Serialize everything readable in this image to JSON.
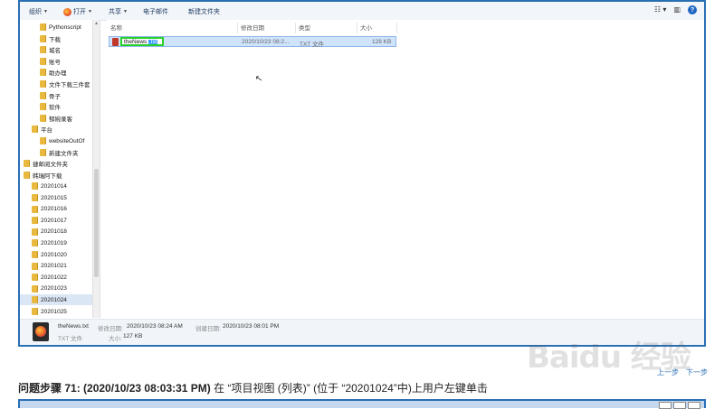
{
  "toolbar": {
    "organize": "组织",
    "open": "打开",
    "share": "共享",
    "email": "电子邮件",
    "new_folder": "新建文件夹"
  },
  "nav": {
    "items": [
      {
        "label": "Pythonscript",
        "indent": 2
      },
      {
        "label": "下载",
        "indent": 2
      },
      {
        "label": "城名",
        "indent": 2
      },
      {
        "label": "账号",
        "indent": 2
      },
      {
        "label": "助办理",
        "indent": 2
      },
      {
        "label": "文件下载三件套",
        "indent": 2
      },
      {
        "label": "骨子",
        "indent": 2
      },
      {
        "label": "软件",
        "indent": 2
      },
      {
        "label": "郁婉录客",
        "indent": 2
      },
      {
        "label": "平台",
        "indent": 1
      },
      {
        "label": "websiteOutOf",
        "indent": 2
      },
      {
        "label": "新建文件夹",
        "indent": 2
      },
      {
        "label": "捷邮阅文件夹",
        "indent": 0
      },
      {
        "label": "韩瑞阿下载",
        "indent": 0
      },
      {
        "label": "20201014",
        "indent": 1
      },
      {
        "label": "20201015",
        "indent": 1
      },
      {
        "label": "20201016",
        "indent": 1
      },
      {
        "label": "20201017",
        "indent": 1
      },
      {
        "label": "20201018",
        "indent": 1
      },
      {
        "label": "20201019",
        "indent": 1
      },
      {
        "label": "20201020",
        "indent": 1
      },
      {
        "label": "20201021",
        "indent": 1
      },
      {
        "label": "20201022",
        "indent": 1
      },
      {
        "label": "20201023",
        "indent": 1
      },
      {
        "label": "20201024",
        "indent": 1,
        "selected": true
      },
      {
        "label": "20201025",
        "indent": 1
      }
    ]
  },
  "columns": {
    "name": "名称",
    "modified": "修改日期",
    "type": "类型",
    "size": "大小"
  },
  "file": {
    "name_prefix": "theNews",
    "name_selected": ".txt",
    "modified": "2020/10/23 08:2...",
    "type": "TXT 文件",
    "size": "128 KB"
  },
  "details": {
    "filename": "theNews.txt",
    "modified_label": "修改日期:",
    "modified_value": "2020/10/23 08:24 AM",
    "created_label": "创建日期:",
    "created_value": "2020/10/23 08:01 PM",
    "type": "TXT 文件",
    "size_label": "大小:",
    "size_value": "127 KB"
  },
  "step": {
    "prev": "上一步",
    "next": "下一步",
    "prefix": "问题步骤",
    "number_time": "71: (2020/10/23 08:03:31 PM)",
    "desc": " 在 “项目视图 (列表)” (位于 “20201024”中)上用户左键单击"
  },
  "watermark": "Baidu 经验"
}
